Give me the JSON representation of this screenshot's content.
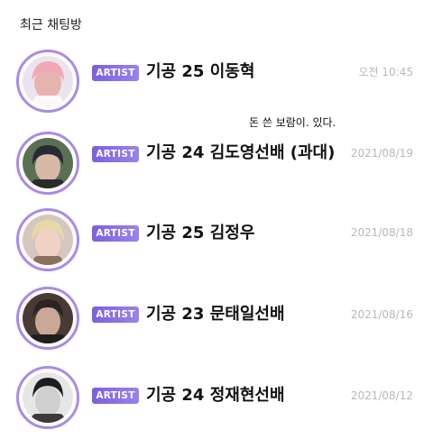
{
  "header": {
    "title": "최근 채팅방"
  },
  "chats": [
    {
      "badge": "ARTIST",
      "name": "기공 25 이동혁",
      "time": "오전 10:45",
      "preview": "돈 쓴 보람이. 있다.",
      "avatar_tone": "#e7b3b0",
      "hair_tone": "#f1a7b5"
    },
    {
      "badge": "ARTIST",
      "name": "기공 24 김도영선배 (과대)",
      "time": "2021/08/19",
      "preview": "",
      "avatar_tone": "#d8b8a8",
      "hair_tone": "#2a2a33"
    },
    {
      "badge": "ARTIST",
      "name": "기공 25 김정우",
      "time": "2021/08/18",
      "preview": "",
      "avatar_tone": "#f0d2c2",
      "hair_tone": "#e8d8a8"
    },
    {
      "badge": "ARTIST",
      "name": "기공 23 문태일선배",
      "time": "2021/08/16",
      "preview": "",
      "avatar_tone": "#c9a897",
      "hair_tone": "#2b2522"
    },
    {
      "badge": "ARTIST",
      "name": "기공 24 정재현선배",
      "time": "2021/08/12",
      "preview": "",
      "avatar_tone": "#cfcfcf",
      "hair_tone": "#1e1e1e"
    }
  ],
  "colors": {
    "accent": "#8a6fe6",
    "ring": "#a98be6",
    "time": "#b8b8b8"
  }
}
